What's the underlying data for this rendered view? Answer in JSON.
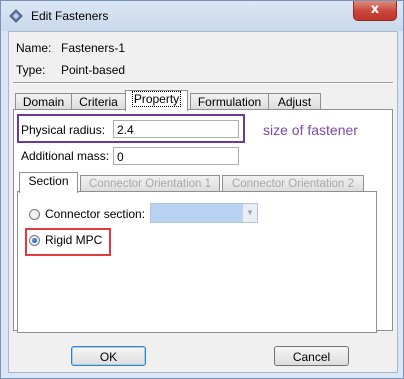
{
  "window": {
    "title": "Edit Fasteners",
    "close_label": "x"
  },
  "info": {
    "name_label": "Name:",
    "name_value": "Fasteners-1",
    "type_label": "Type:",
    "type_value": "Point-based"
  },
  "tabs": [
    {
      "label": "Domain"
    },
    {
      "label": "Criteria"
    },
    {
      "label": "Property"
    },
    {
      "label": "Formulation"
    },
    {
      "label": "Adjust"
    }
  ],
  "property": {
    "physical_radius_label": "Physical radius:",
    "physical_radius_value": "2.4",
    "additional_mass_label": "Additional mass:",
    "additional_mass_value": "0",
    "annotation": "size of fastener"
  },
  "subtabs": [
    {
      "label": "Section"
    },
    {
      "label": "Connector Orientation 1"
    },
    {
      "label": "Connector Orientation 2"
    }
  ],
  "section": {
    "connector_section_label": "Connector section:",
    "connector_section_value": "",
    "rigid_mpc_label": "Rigid MPC",
    "selected": "Rigid MPC"
  },
  "buttons": {
    "ok": "OK",
    "cancel": "Cancel"
  },
  "colors": {
    "title_bar": "#c9d8ec",
    "close": "#c7453a",
    "highlight_purple": "#6a3a9a",
    "highlight_red": "#e03c3c",
    "annotation": "#7a4aa8"
  }
}
